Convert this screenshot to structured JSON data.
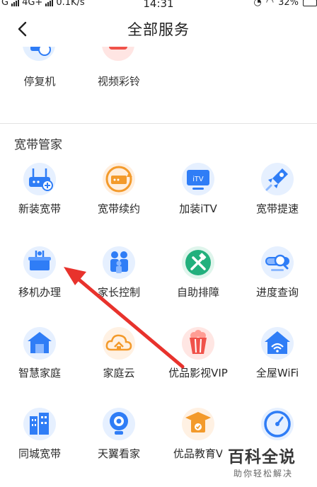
{
  "status_bar": {
    "carrier_left": "G",
    "network": "4G+",
    "speed": "0.1K/s",
    "time": "14:31",
    "battery": "32%"
  },
  "header": {
    "title": "全部服务"
  },
  "partial_row": [
    {
      "label": "停复机"
    },
    {
      "label": "视频彩铃"
    }
  ],
  "section": {
    "title": "宽带管家"
  },
  "services": [
    {
      "label": "新装宽带",
      "icon": "router-plus-icon"
    },
    {
      "label": "宽带续约",
      "icon": "router-renew-icon"
    },
    {
      "label": "加装iTV",
      "icon": "itv-tv-icon"
    },
    {
      "label": "宽带提速",
      "icon": "rocket-icon"
    },
    {
      "label": "移机办理",
      "icon": "relocate-box-icon"
    },
    {
      "label": "家长控制",
      "icon": "family-icon"
    },
    {
      "label": "自助排障",
      "icon": "hammer-wrench-icon"
    },
    {
      "label": "进度查询",
      "icon": "progress-search-icon"
    },
    {
      "label": "智慧家庭",
      "icon": "smart-home-icon"
    },
    {
      "label": "家庭云",
      "icon": "home-cloud-icon"
    },
    {
      "label": "优品影视VIP",
      "icon": "popcorn-icon"
    },
    {
      "label": "全屋WiFi",
      "icon": "house-wifi-icon"
    },
    {
      "label": "同城宽带",
      "icon": "city-building-icon"
    },
    {
      "label": "天翼看家",
      "icon": "camera-icon"
    },
    {
      "label": "优品教育V",
      "icon": "graduation-cap-icon"
    },
    {
      "label": "",
      "icon": "speedometer-icon"
    }
  ],
  "watermark": {
    "title": "百科全说",
    "subtitle": "助你轻松解决"
  },
  "colors": {
    "blue": "#2f7df6",
    "light_blue": "#e3efff",
    "orange": "#f39a2b",
    "red": "#f0524a",
    "green": "#22b07d",
    "annotation_red": "#e8322c"
  }
}
